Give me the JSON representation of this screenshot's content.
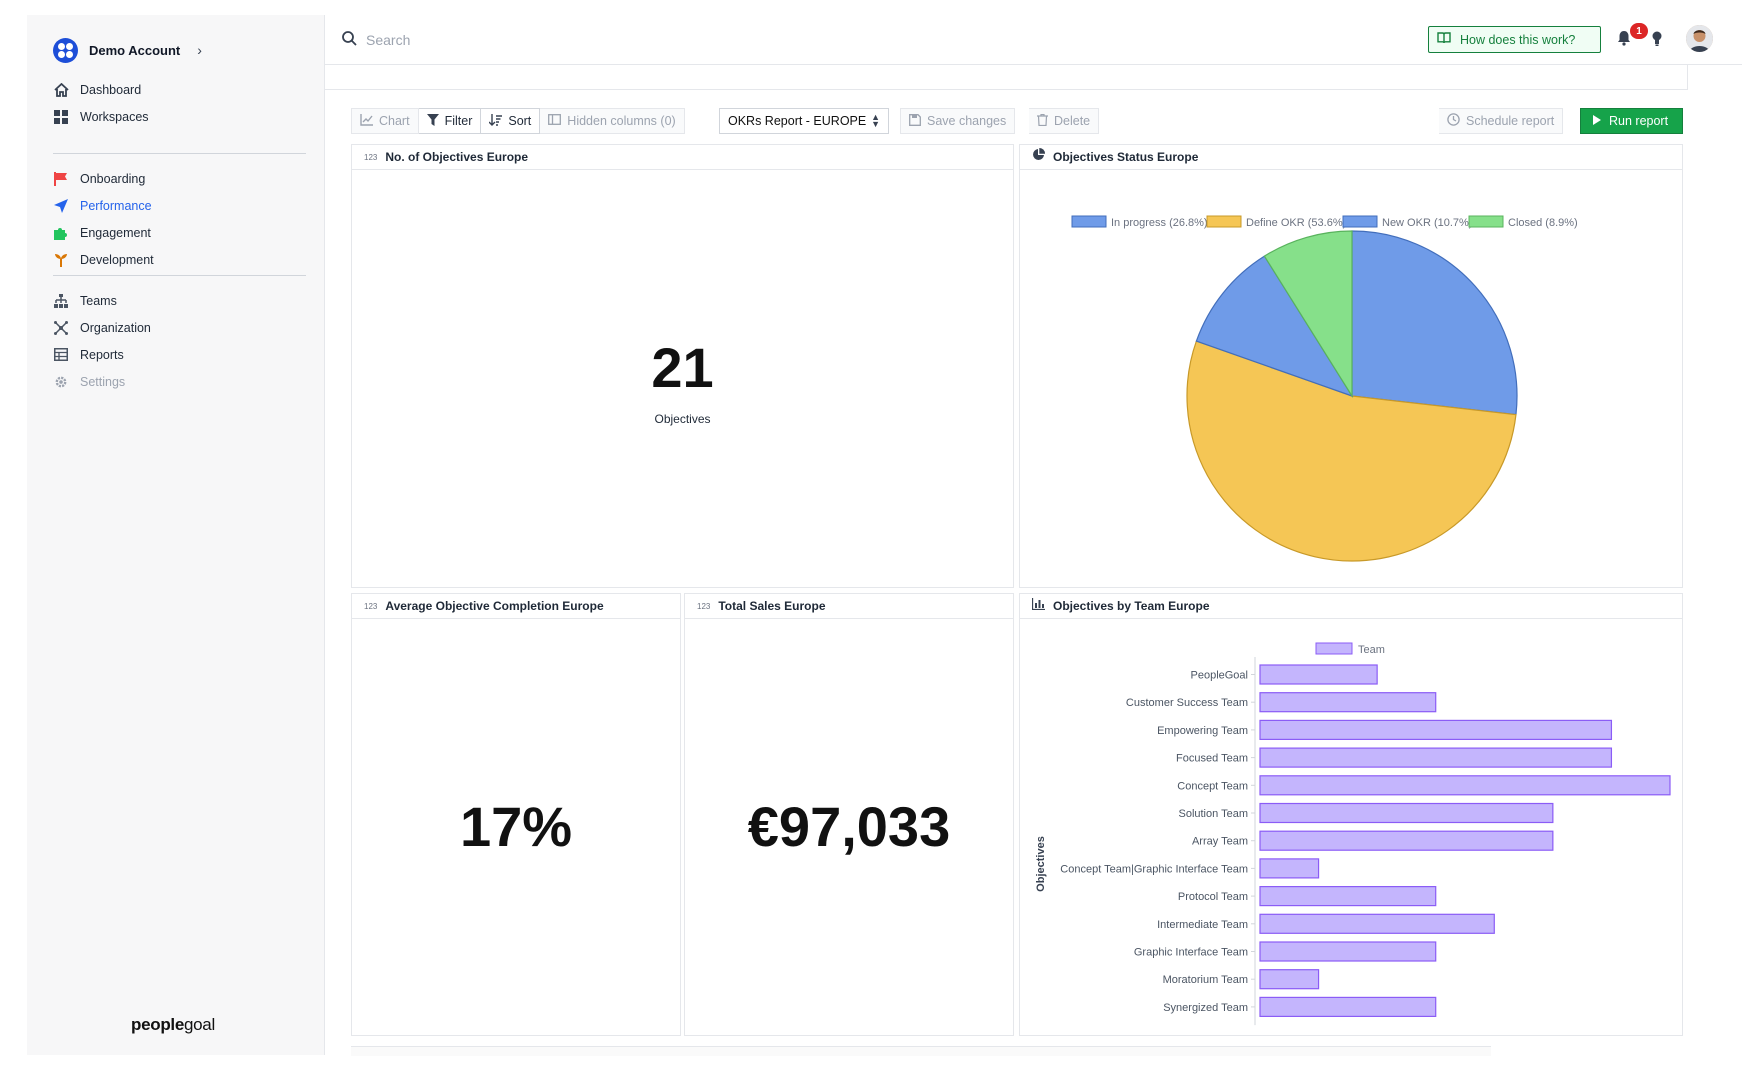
{
  "account": {
    "name": "Demo Account"
  },
  "sidebar": {
    "group1": [
      {
        "label": "Dashboard",
        "icon": "home-icon"
      },
      {
        "label": "Workspaces",
        "icon": "grid-icon"
      }
    ],
    "group2": [
      {
        "label": "Onboarding",
        "icon": "flag-icon",
        "color": "#ef4444"
      },
      {
        "label": "Performance",
        "icon": "paper-plane-icon",
        "color": "#2563eb",
        "active": true
      },
      {
        "label": "Engagement",
        "icon": "puzzle-icon",
        "color": "#22c55e"
      },
      {
        "label": "Development",
        "icon": "sprout-icon",
        "color": "#d97706"
      }
    ],
    "group3": [
      {
        "label": "Teams",
        "icon": "hierarchy-icon"
      },
      {
        "label": "Organization",
        "icon": "network-icon"
      },
      {
        "label": "Reports",
        "icon": "table-icon"
      },
      {
        "label": "Settings",
        "icon": "gear-icon",
        "muted": true
      }
    ],
    "brand_bold": "people",
    "brand_light": "goal"
  },
  "topbar": {
    "search_placeholder": "Search",
    "help_label": "How does this work?",
    "notification_count": "1"
  },
  "toolbar": {
    "chart": "Chart",
    "filter": "Filter",
    "sort": "Sort",
    "hidden_columns": "Hidden columns (0)",
    "report_select": "OKRs Report - EUROPE",
    "save": "Save changes",
    "delete": "Delete",
    "schedule": "Schedule report",
    "run": "Run report"
  },
  "cards": {
    "objectives_count": {
      "icon": "123",
      "title": "No. of Objectives Europe",
      "value": "21",
      "caption": "Objectives"
    },
    "completion": {
      "icon": "123",
      "title": "Average Objective Completion Europe",
      "value": "17%"
    },
    "sales": {
      "icon": "123",
      "title": "Total Sales Europe",
      "value": "€97,033"
    },
    "status": {
      "title": "Objectives Status Europe"
    },
    "by_team": {
      "title": "Objectives by Team Europe"
    }
  },
  "chart_data": [
    {
      "type": "pie",
      "title": "Objectives Status Europe",
      "legend_position": "top",
      "slices": [
        {
          "label": "In progress (26.8%)",
          "value": 26.8,
          "color": "#6f9be8"
        },
        {
          "label": "Define OKR (53.6%)",
          "value": 53.6,
          "color": "#f5c655"
        },
        {
          "label": "New OKR (10.7%)",
          "value": 10.7,
          "color": "#6f9be8"
        },
        {
          "label": "Closed (8.9%)",
          "value": 8.9,
          "color": "#86e08a"
        }
      ]
    },
    {
      "type": "bar",
      "orientation": "horizontal",
      "title": "Objectives by Team Europe",
      "ylabel": "Objectives",
      "legend_position": "top",
      "series": [
        {
          "name": "Team",
          "color": "#c4b5fd"
        }
      ],
      "categories": [
        "PeopleGoal",
        "Customer Success Team",
        "Empowering Team",
        "Focused Team",
        "Concept Team",
        "Solution Team",
        "Array Team",
        "Concept Team|Graphic Interface Team",
        "Protocol Team",
        "Intermediate Team",
        "Graphic Interface Team",
        "Moratorium Team",
        "Synergized Team"
      ],
      "values": [
        2,
        3,
        6,
        6,
        7,
        5,
        5,
        1,
        3,
        4,
        3,
        1,
        3
      ],
      "xlim": [
        0,
        7
      ]
    }
  ]
}
